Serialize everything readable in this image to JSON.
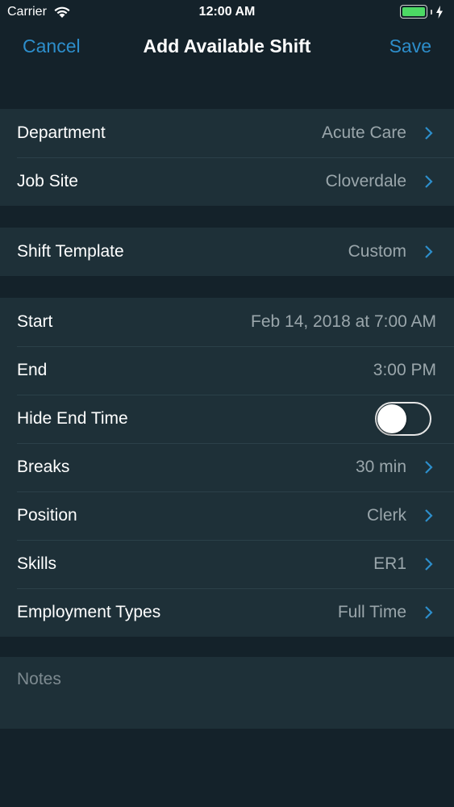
{
  "status_bar": {
    "carrier": "Carrier",
    "time": "12:00 AM",
    "battery_color": "#4cd964"
  },
  "nav": {
    "cancel": "Cancel",
    "title": "Add Available Shift",
    "save": "Save",
    "accent_color": "#2d8ecb"
  },
  "location": {
    "department": {
      "label": "Department",
      "value": "Acute Care"
    },
    "job_site": {
      "label": "Job Site",
      "value": "Cloverdale"
    }
  },
  "template": {
    "shift_template": {
      "label": "Shift Template",
      "value": "Custom"
    }
  },
  "details": {
    "start": {
      "label": "Start",
      "value": "Feb 14, 2018 at 7:00 AM"
    },
    "end": {
      "label": "End",
      "value": "3:00 PM"
    },
    "hide_end_time": {
      "label": "Hide End Time",
      "on": false
    },
    "breaks": {
      "label": "Breaks",
      "value": "30 min"
    },
    "position": {
      "label": "Position",
      "value": "Clerk"
    },
    "skills": {
      "label": "Skills",
      "value": "ER1"
    },
    "employment_types": {
      "label": "Employment Types",
      "value": "Full Time"
    }
  },
  "notes": {
    "placeholder": "Notes"
  }
}
